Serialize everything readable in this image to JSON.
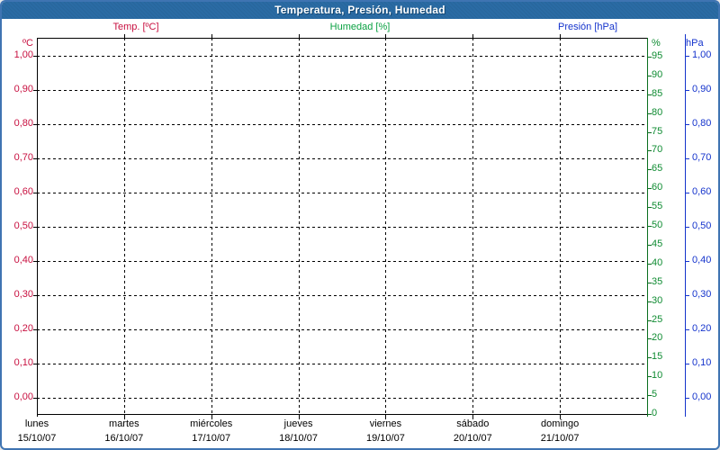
{
  "window": {
    "title": "Temperatura, Presión, Humedad"
  },
  "colors": {
    "titlebar": "#2a6ba4",
    "frame_border": "#3f74b2",
    "background": "#ffffff",
    "grid": "#000000",
    "temp_accent": "#c81040",
    "humidity_accent": "#0f8c32",
    "humidity_axis_line": "#0a6e1e",
    "pressure_accent": "#1433cc",
    "x_label_text": "#000000"
  },
  "chart_data": {
    "type": "line",
    "title": "Temperatura, Presión, Humedad",
    "grid": {
      "style": "dashed",
      "color": "#000000",
      "horizontal": true,
      "vertical_per_day": true
    },
    "series": [
      {
        "name": "Temp. [ºC]",
        "color": "#c81040",
        "values": []
      },
      {
        "name": "Humedad [%]",
        "color": "#0aa142",
        "values": []
      },
      {
        "name": "Presión [hPa]",
        "color": "#1433cc",
        "values": []
      }
    ],
    "x_axis": {
      "days": [
        {
          "name": "lunes",
          "date": "15/10/07"
        },
        {
          "name": "martes",
          "date": "16/10/07"
        },
        {
          "name": "miércoles",
          "date": "17/10/07"
        },
        {
          "name": "jueves",
          "date": "18/10/07"
        },
        {
          "name": "viernes",
          "date": "19/10/07"
        },
        {
          "name": "sábado",
          "date": "20/10/07"
        },
        {
          "name": "domingo",
          "date": "21/10/07"
        }
      ]
    },
    "y_axes": {
      "temp": {
        "unit": "ºC",
        "side": "left",
        "tick_labels": [
          "1,00",
          "0,90",
          "0,80",
          "0,70",
          "0,60",
          "0,50",
          "0,40",
          "0,30",
          "0,20",
          "0,10",
          "0,00"
        ],
        "tick_values": [
          1.0,
          0.9,
          0.8,
          0.7,
          0.6,
          0.5,
          0.4,
          0.3,
          0.2,
          0.1,
          0.0
        ],
        "range_shown": [
          0,
          1
        ]
      },
      "humidity": {
        "unit": "%",
        "side": "right-inner",
        "tick_labels": [
          "95",
          "90",
          "85",
          "80",
          "75",
          "70",
          "65",
          "60",
          "55",
          "50",
          "45",
          "40",
          "35",
          "30",
          "25",
          "20",
          "15",
          "10",
          "5",
          "0"
        ],
        "tick_values": [
          95,
          90,
          85,
          80,
          75,
          70,
          65,
          60,
          55,
          50,
          45,
          40,
          35,
          30,
          25,
          20,
          15,
          10,
          5,
          0
        ],
        "range": [
          0,
          100
        ]
      },
      "pressure": {
        "unit": "hPa",
        "side": "right-outer",
        "tick_labels": [
          "1,00",
          "0,90",
          "0,80",
          "0,70",
          "0,60",
          "0,50",
          "0,40",
          "0,30",
          "0,20",
          "0,10",
          "0,00"
        ],
        "tick_values": [
          1.0,
          0.9,
          0.8,
          0.7,
          0.6,
          0.5,
          0.4,
          0.3,
          0.2,
          0.1,
          0.0
        ],
        "range_shown": [
          0,
          1
        ]
      }
    }
  }
}
